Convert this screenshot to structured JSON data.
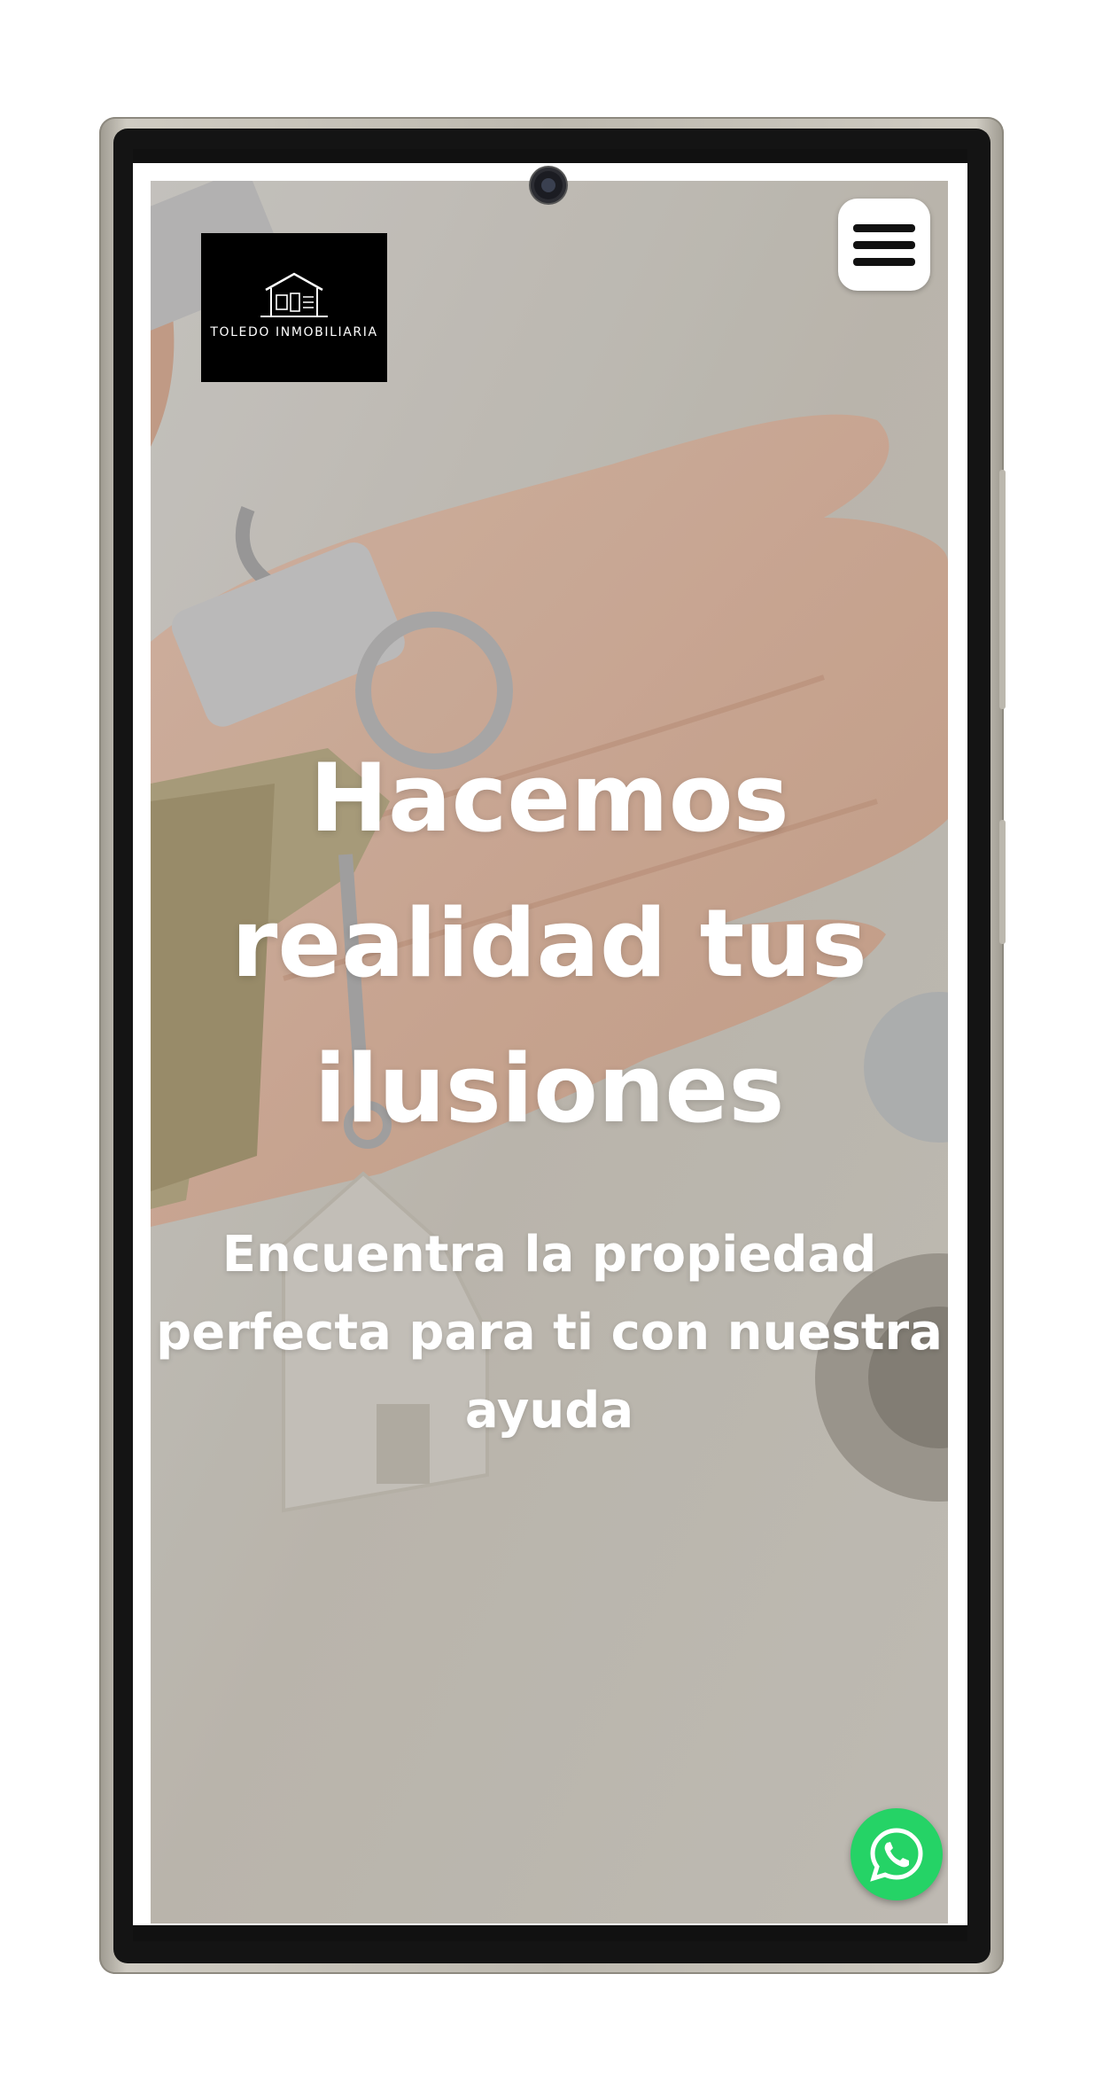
{
  "logo": {
    "text": "TOLEDO INMOBILIARIA"
  },
  "hero": {
    "title_line1": "Hacemos",
    "title_line2": "realidad tus",
    "title_line3": "ilusiones",
    "subtitle_line1": "Encuentra la propiedad",
    "subtitle_line2": "perfecta para ti con nuestra",
    "subtitle_line3": "ayuda"
  },
  "icons": {
    "menu": "hamburger-menu-icon",
    "whatsapp": "whatsapp-icon",
    "logo_mark": "house-icon"
  },
  "colors": {
    "whatsapp": "#25d366",
    "logo_bg": "#000000",
    "text": "#ffffff"
  }
}
